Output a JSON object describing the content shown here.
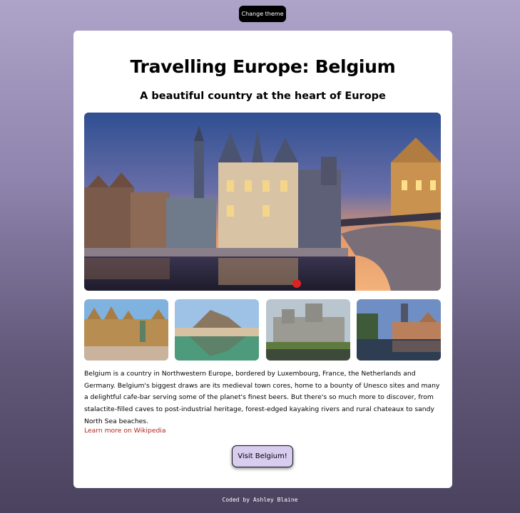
{
  "header": {
    "theme_button_label": "Change theme"
  },
  "card": {
    "title": "Travelling Europe: Belgium",
    "subtitle": "A beautiful country at the heart of Europe",
    "hero_image": "ghent-canal-evening-photo",
    "gallery": [
      {
        "image": "antwerp-grote-markt-photo"
      },
      {
        "image": "dinant-river-cliffs-photo"
      },
      {
        "image": "gravensteen-castle-photo"
      },
      {
        "image": "bruges-canal-photo"
      }
    ],
    "description": "Belgium is a country in Northwestern Europe, bordered by Luxembourg, France, the Netherlands and Germany. Belgium's biggest draws are its medieval town cores, home to a bounty of Unesco sites and many a delightful cafe-bar serving some of the planet's finest beers. But there's so much more to discover, from stalactite-filled caves to post-industrial heritage, forest-edged kayaking rivers and rural chateaux to sandy North Sea beaches.",
    "wiki_link_label": "Learn more on Wikipedia",
    "visit_button_label": "Visit Belgium!"
  },
  "footer": {
    "credit": "Coded by Ashley Blaine"
  },
  "colors": {
    "background_top": "#aea3c8",
    "background_bottom": "#4a425e",
    "link": "#b3261e",
    "visit_button": "#d8ccef"
  }
}
